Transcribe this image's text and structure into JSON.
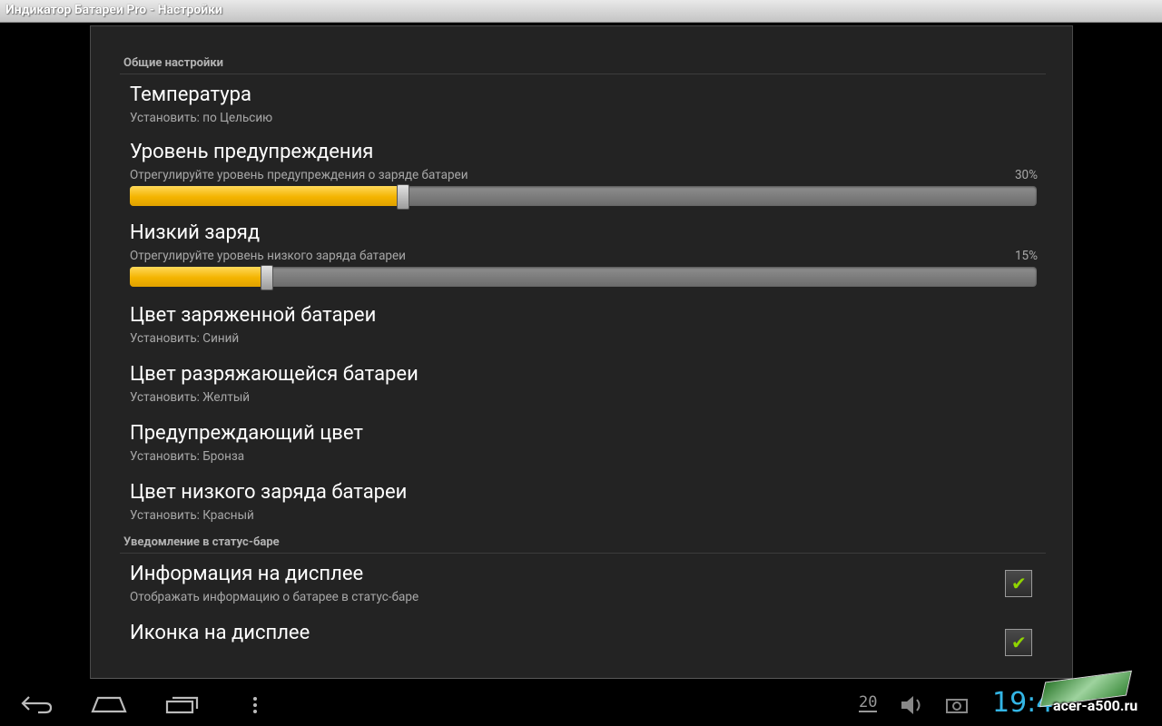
{
  "window": {
    "title": "Индикатор Батареи Pro - Настройки"
  },
  "sections": {
    "general": {
      "header": "Общие настройки"
    },
    "statusbar": {
      "header": "Уведомление в статус-баре"
    }
  },
  "prefs": {
    "temperature": {
      "title": "Температура",
      "summary": "Установить: по Цельсию"
    },
    "warning_level": {
      "title": "Уровень предупреждения",
      "summary": "Отрегулируйте уровень предупреждения о заряде батареи",
      "value_text": "30%",
      "value": 30
    },
    "low_charge": {
      "title": "Низкий заряд",
      "summary": "Отрегулируйте уровень низкого заряда батареи",
      "value_text": "15%",
      "value": 15
    },
    "charged_color": {
      "title": "Цвет заряженной батареи",
      "summary": "Установить: Синий"
    },
    "discharging_color": {
      "title": "Цвет разряжающейся батареи",
      "summary": "Установить: Желтый"
    },
    "warning_color": {
      "title": "Предупреждающий цвет",
      "summary": "Установить: Бронза"
    },
    "low_charge_color": {
      "title": "Цвет низкого заряда батареи",
      "summary": "Установить: Красный"
    },
    "display_info": {
      "title": "Информация на дисплее",
      "summary": "Отображать информацию о батарее в статус-баре",
      "checked": true
    },
    "display_icon": {
      "title": "Иконка на дисплее",
      "checked": true
    }
  },
  "navbar": {
    "icons": [
      "back-icon",
      "home-icon",
      "recent-apps-icon",
      "menu-icon"
    ],
    "status": {
      "notification_count": "20",
      "clock": "19:4"
    },
    "watermark": "acer-a500.ru"
  },
  "colors": {
    "accent": "#f4b400",
    "clock": "#33b5e5",
    "checkmark": "#8fd400",
    "panel": "#232323"
  }
}
